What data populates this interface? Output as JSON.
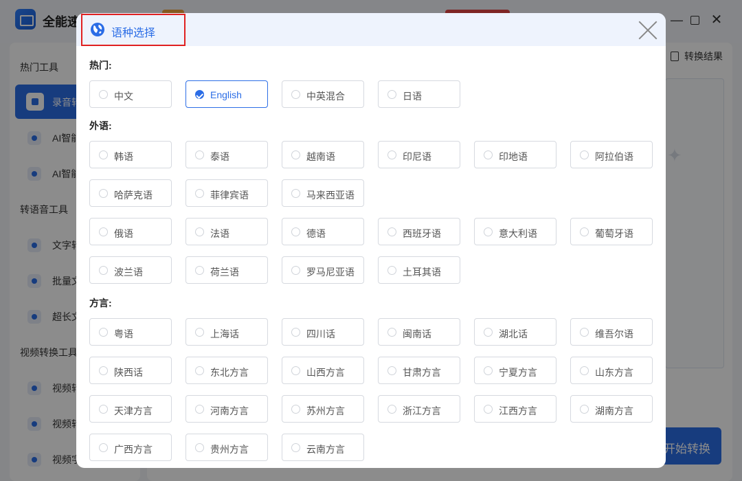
{
  "app": {
    "title": "全能速",
    "result_link": "转换结果",
    "start_button": "开始转换"
  },
  "sidebar": {
    "groups": [
      {
        "label": "热门工具",
        "items": [
          {
            "label": "录音转",
            "active": true,
            "icon": "audio-file-icon"
          },
          {
            "label": "AI智能",
            "icon": "ai-upload-icon"
          },
          {
            "label": "AI智能",
            "icon": "ai-pen-icon"
          }
        ]
      },
      {
        "label": "转语音工具",
        "items": [
          {
            "label": "文字转",
            "icon": "text-voice-icon"
          },
          {
            "label": "批量文",
            "icon": "batch-voice-icon"
          },
          {
            "label": "超长文",
            "icon": "long-text-voice-icon"
          }
        ]
      },
      {
        "label": "视频转换工具",
        "items": [
          {
            "label": "视频转",
            "icon": "video-text-icon"
          },
          {
            "label": "视频转",
            "icon": "video-music-icon"
          },
          {
            "label": "视频字",
            "icon": "video-subtitle-icon"
          }
        ]
      }
    ]
  },
  "dialog": {
    "title": "语种选择",
    "selected": "English",
    "sections": [
      {
        "label": "热门:",
        "rows": [
          [
            "中文",
            "English",
            "中英混合",
            "日语"
          ]
        ]
      },
      {
        "label": "外语:",
        "rows": [
          [
            "韩语",
            "泰语",
            "越南语",
            "印尼语",
            "印地语",
            "阿拉伯语"
          ],
          [
            "哈萨克语",
            "菲律宾语",
            "马来西亚语"
          ],
          [
            "俄语",
            "法语",
            "德语",
            "西班牙语",
            "意大利语",
            "葡萄牙语"
          ],
          [
            "波兰语",
            "荷兰语",
            "罗马尼亚语",
            "土耳其语"
          ]
        ]
      },
      {
        "label": "方言:",
        "rows": [
          [
            "粤语",
            "上海话",
            "四川话",
            "闽南话",
            "湖北话",
            "维吾尔语"
          ],
          [
            "陕西话",
            "东北方言",
            "山西方言",
            "甘肃方言",
            "宁夏方言",
            "山东方言"
          ],
          [
            "天津方言",
            "河南方言",
            "苏州方言",
            "浙江方言",
            "江西方言",
            "湖南方言"
          ],
          [
            "广西方言",
            "贵州方言",
            "云南方言"
          ]
        ]
      }
    ]
  },
  "colors": {
    "accent": "#2b6de6",
    "highlight_box": "#e02020"
  }
}
